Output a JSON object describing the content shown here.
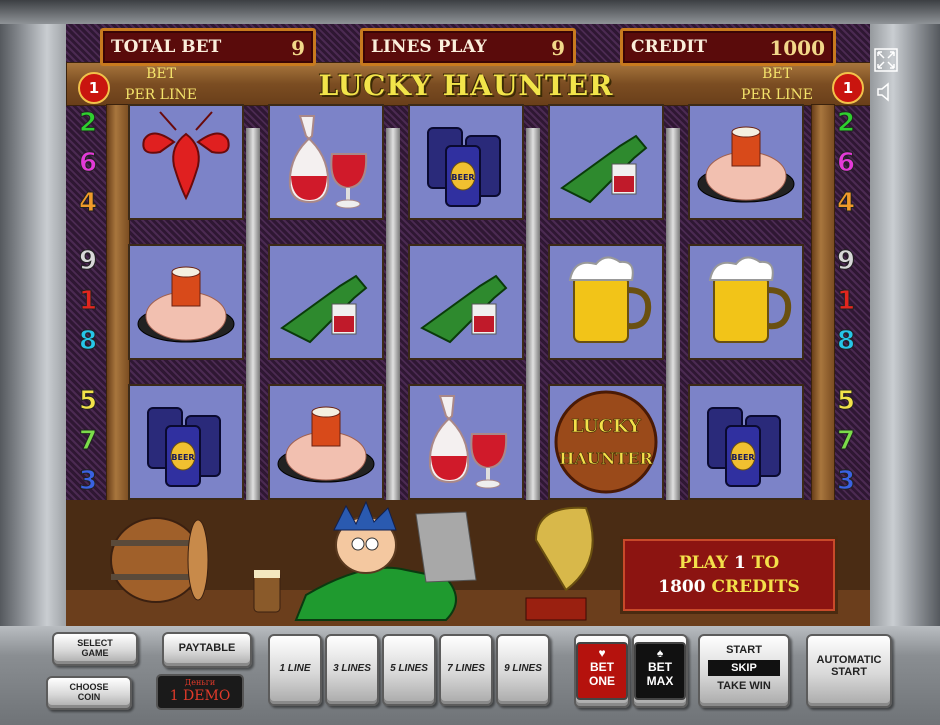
{
  "header": {
    "total_bet_label": "TOTAL BET",
    "total_bet_value": "9",
    "lines_play_label": "LINES PLAY",
    "lines_play_value": "9",
    "credit_label": "CREDIT",
    "credit_value": "1000"
  },
  "title": "LUCKY HAUNTER",
  "bet_per_line": {
    "left_label_1": "BET",
    "left_label_2": "PER LINE",
    "right_label_1": "BET",
    "right_label_2": "PER LINE",
    "left_value": "1",
    "right_value": "1"
  },
  "line_numbers": {
    "left": [
      "2",
      "6",
      "4",
      "9",
      "1",
      "8",
      "5",
      "7",
      "3"
    ],
    "right": [
      "2",
      "6",
      "4",
      "9",
      "1",
      "8",
      "5",
      "7",
      "3"
    ]
  },
  "line_colors": [
    "#2fcf2f",
    "#e33ad8",
    "#f09a2a",
    "#d8d8d8",
    "#e2261f",
    "#27c6e8",
    "#f2e34a",
    "#7bdc4a",
    "#3a62e2"
  ],
  "reels": [
    [
      "lobster",
      "shrimp-plate",
      "beer-cans"
    ],
    [
      "wine-carafe",
      "wine-bottle",
      "shrimp-plate"
    ],
    [
      "beer-cans",
      "wine-bottle",
      "wine-carafe"
    ],
    [
      "wine-bottle",
      "beer-mug",
      "lucky-haunter-logo"
    ],
    [
      "shrimp-plate",
      "beer-mug",
      "beer-cans"
    ]
  ],
  "logo_text": {
    "top": "LUCKY",
    "bottom": "HAUNTER"
  },
  "beer_label": "BEER",
  "play_box": {
    "line1_a": "PLAY ",
    "line1_b": "1",
    "line1_c": " TO",
    "line2_a": "1800",
    "line2_b": " CREDITS"
  },
  "buttons": {
    "select_game_1": "SELECT",
    "select_game_2": "GAME",
    "choose_coin_1": "CHOOSE",
    "choose_coin_2": "COIN",
    "paytable": "PAYTABLE",
    "demo_small": "Деньги",
    "demo": "1 DEMO",
    "line1": "1 LINE",
    "line3": "3 LINES",
    "line5": "5 LINES",
    "line7": "7 LINES",
    "line9": "9 LINES",
    "bet_one_1": "BET",
    "bet_one_2": "ONE",
    "bet_max_1": "BET",
    "bet_max_2": "MAX",
    "start": "START",
    "skip": "SKIP",
    "take_win": "TAKE WIN",
    "automatic_1": "AUTOMATIC",
    "automatic_2": "START"
  },
  "icons": [
    "fullscreen-icon",
    "sound-icon"
  ],
  "colors": {
    "display_bg": "#5a0b0b",
    "display_border": "#c87a1e",
    "reel_bg": "#7c83c8",
    "title": "#f2e44a"
  }
}
